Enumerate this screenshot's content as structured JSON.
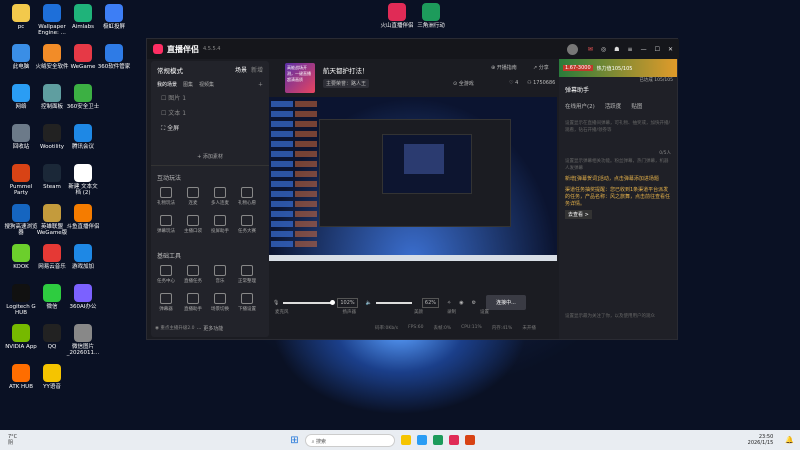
{
  "desktop": {
    "icons": [
      {
        "label": "pc",
        "color": "#f2c94c"
      },
      {
        "label": "Wallpaper Engine: ...",
        "color": "#1e6fd9"
      },
      {
        "label": "Aimlabs",
        "color": "#1fb37a"
      },
      {
        "label": "极虹投屏",
        "color": "#3d7ef5"
      },
      {
        "label": "此电脑",
        "color": "#3a8ee6"
      },
      {
        "label": "火绒安全软件",
        "color": "#f28c28"
      },
      {
        "label": "WeGame",
        "color": "#e63946"
      },
      {
        "label": "360软件管家",
        "color": "#2e7be6"
      },
      {
        "label": "网络",
        "color": "#2a9df4"
      },
      {
        "label": "控制面板",
        "color": "#5f9ea0"
      },
      {
        "label": "360安全卫士",
        "color": "#3cb043"
      },
      {
        "label": "回收站",
        "color": "#6c7a89"
      },
      {
        "label": "Wootility",
        "color": "#222"
      },
      {
        "label": "腾讯会议",
        "color": "#1e88e5"
      },
      {
        "label": "Pummel Party",
        "color": "#d84315"
      },
      {
        "label": "Steam",
        "color": "#1b2838"
      },
      {
        "label": "新建 文本文档 (2)",
        "color": "#ffffff"
      },
      {
        "label": "搜狗高速浏览器",
        "color": "#1565c0"
      },
      {
        "label": "英雄联盟WeGame版",
        "color": "#c49b3c"
      },
      {
        "label": "斗鱼直播伴侣",
        "color": "#f57c00"
      },
      {
        "label": "KOOK",
        "color": "#6ccf2c"
      },
      {
        "label": "网易云音乐",
        "color": "#e53935"
      },
      {
        "label": "游戏加加",
        "color": "#1e88e5"
      },
      {
        "label": "Logitech G HUB",
        "color": "#111"
      },
      {
        "label": "微信",
        "color": "#2ecc40"
      },
      {
        "label": "360AI办公",
        "color": "#7b61ff"
      },
      {
        "label": "NVIDIA App",
        "color": "#76b900"
      },
      {
        "label": "QQ",
        "color": "#222"
      },
      {
        "label": "微信图片_2026011...",
        "color": "#888"
      },
      {
        "label": "ATK HUB",
        "color": "#ff6d00"
      },
      {
        "label": "YY语音",
        "color": "#f5c400"
      }
    ],
    "top_icons": [
      {
        "label": "火山直播伴侣",
        "color": "#e02b56"
      },
      {
        "label": "三角洲行动",
        "color": "#1d9b5b"
      }
    ]
  },
  "app": {
    "name": "直播伴侣",
    "version": "4.5.5.4",
    "ad_title": "航天都护打法！",
    "streamer_tag": "主要荣誉：路人王",
    "ad_img_text": "高能战场开测，一键直播 超清画质",
    "game_mode": "全游戏",
    "likes": "4",
    "viewers": "1750686",
    "open_live": "开播指南",
    "share": "分享"
  },
  "left": {
    "mode": "常规模式",
    "tab1": "场景",
    "tab2": "新增",
    "scene_tabs": [
      "我的场景",
      "图集",
      "视频集"
    ],
    "scene1": "图片 1",
    "scene2": "文本 1",
    "scene3": "全屏",
    "add_material": "+ 添加素材",
    "interact_title": "互动玩法",
    "interact": [
      "礼物玩法",
      "连麦",
      "多人连麦",
      "礼物心愿",
      "弹幕玩法",
      "主播口袋",
      "投屏助手",
      "任务大赛"
    ],
    "basic_title": "基础工具",
    "basic": [
      "任务中心",
      "直播任务",
      "音乐",
      "正常整理",
      "弹幕器",
      "直播助手",
      "场景切换",
      "下播设置"
    ],
    "more": "更多功能",
    "bottom": "重点主播升级2.0"
  },
  "controls": {
    "mic_label": "麦克风",
    "mic_level": "102%",
    "spk_label": "扬声器",
    "spk_level": "62%",
    "b1": "美颜",
    "b2": "录制",
    "b3": "设置",
    "go_live": "连接中..."
  },
  "status": {
    "s1": "码率:0Kb/s",
    "s2": "FPS:60",
    "s3": "丢帧:0%",
    "s4": "CPU:11%",
    "s5": "内存:41%",
    "s6": "未开播"
  },
  "right": {
    "header_score": "1.67-3000",
    "header_btn": "热力值105/105",
    "header_sub": "已达成 105/105",
    "title": "弹幕助手",
    "tabs": [
      "在线用户(2)",
      "活跃度",
      "贴图"
    ],
    "empty_hint": "设置显示在直播间弹幕，可礼物、抽奖或，加快开播/观看，钻石开播/领券等",
    "count": "0/5人",
    "notice_lines": "设置显示弹幕相关功能。粉丝弹幕，热门弹幕，机器人发弹幕",
    "sys1": "新增[弹幕贺词]活动，点击弹幕添加进场题",
    "sys2": "渠道任务抽奖提醒：您已收到1条渠道平台派发的任务，产品名称：风之旅舞，点击前往查看任务详情。",
    "view": "去查看 >",
    "bottom_hint": "设置显示最为关注了你，以及使用用户的观众"
  },
  "taskbar": {
    "temp": "7°C",
    "weather": "阴",
    "search": "搜索",
    "time": "23:50",
    "date": "2026/1/15"
  },
  "icons": {
    "win": "windows-icon",
    "search": "search-icon",
    "notif": "bell-icon"
  }
}
